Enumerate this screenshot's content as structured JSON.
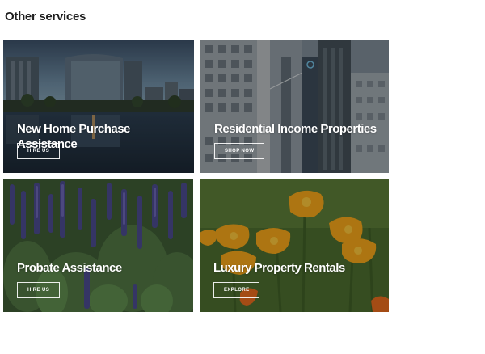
{
  "section": {
    "title": "Other services",
    "accent_color": "#4fd1c5"
  },
  "cards": [
    {
      "title": "New Home Purchase Assistance",
      "button": "HIRE US",
      "image": "city-waterfront-skyline"
    },
    {
      "title": "Residential Income Properties",
      "button": "SHOP NOW",
      "image": "downtown-high-rises-bridge"
    },
    {
      "title": "Probate Assistance",
      "button": "HIRE US",
      "image": "purple-lavender-flowers"
    },
    {
      "title": "Luxury Property Rentals",
      "button": "EXPLORE",
      "image": "orange-poppy-flowers"
    }
  ]
}
